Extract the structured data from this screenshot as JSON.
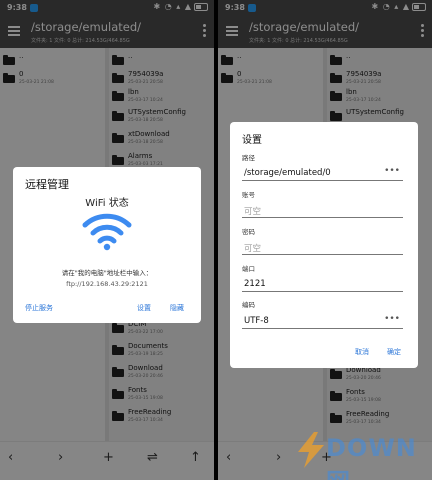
{
  "status": {
    "time": "9:38",
    "icons": "✱ ◔ ▴ ▲"
  },
  "appbar": {
    "path": "/storage/emulated/",
    "meta": "文件夹: 1  文件: 0  总计: 214.53G/464.85G"
  },
  "left_column": [
    {
      "name": "..",
      "date": ""
    },
    {
      "name": "0",
      "date": "25-03-21 21:08"
    }
  ],
  "right_column": [
    {
      "name": "..",
      "date": ""
    },
    {
      "name": "7954039a",
      "date": "25-03-21 20:58"
    },
    {
      "name": "lbn",
      "date": "25-03-17 10:24"
    },
    {
      "name": "UTSystemConfig",
      "date": "25-03-18 20:58"
    },
    {
      "name": "xtDownload",
      "date": "25-03-18 20:58"
    },
    {
      "name": "Alarms",
      "date": "25-03-03 17:21"
    },
    {
      "name": "",
      "date": ""
    },
    {
      "name": "",
      "date": ""
    },
    {
      "name": "",
      "date": ""
    },
    {
      "name": "",
      "date": ""
    },
    {
      "name": "",
      "date": ""
    },
    {
      "name": "",
      "date": ""
    },
    {
      "name": "",
      "date": ""
    },
    {
      "name": "",
      "date": ""
    },
    {
      "name": "DCIM",
      "date": "25-03-22 17:00"
    },
    {
      "name": "Documents",
      "date": "25-03-19 18:25"
    },
    {
      "name": "Download",
      "date": "25-03-20 20:46"
    },
    {
      "name": "Fonts",
      "date": "25-03-15 19:08"
    },
    {
      "name": "FreeReading",
      "date": "25-03-17 10:34"
    }
  ],
  "bottombar": {
    "back": "‹",
    "forward": "›",
    "add": "+",
    "sort": "⇌",
    "up": "↑"
  },
  "remote_dialog": {
    "title": "远程管理",
    "subtitle": "WiFi 状态",
    "hint": "请在\"我的电脑\"地址栏中输入：",
    "address": "ftp://192.168.43.29:2121",
    "stop_label": "停止服务",
    "settings_label": "设置",
    "hide_label": "隐藏"
  },
  "settings_dialog": {
    "title": "设置",
    "path_label": "路径",
    "path_value": "/storage/emulated/0",
    "account_label": "账号",
    "account_placeholder": "可空",
    "password_label": "密码",
    "password_placeholder": "可空",
    "port_label": "端口",
    "port_value": "2121",
    "encoding_label": "编码",
    "encoding_value": "UTF-8",
    "cancel_label": "取消",
    "ok_label": "确定"
  },
  "watermark": {
    "text": "DOWN网"
  },
  "colors": {
    "accent": "#2b76d8",
    "bar": "#4b4b4b",
    "wifi": "#3d8bf0"
  }
}
